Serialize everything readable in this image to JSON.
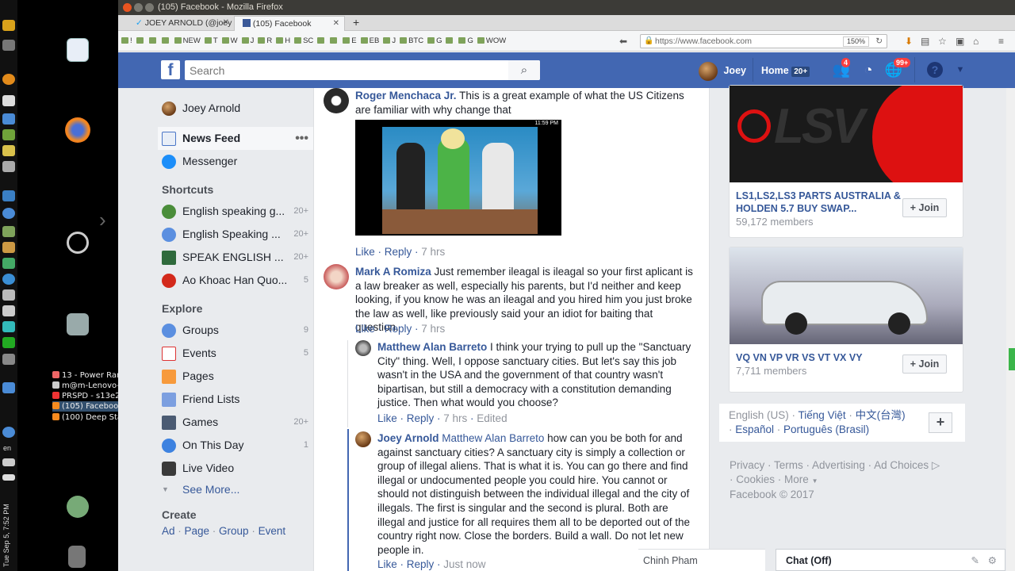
{
  "window": {
    "title": "(105) Facebook - Mozilla Firefox"
  },
  "tabs": [
    {
      "label": "JOEY ARNOLD (@joey"
    },
    {
      "label": "(105) Facebook"
    }
  ],
  "toolbar": {
    "url": "https://www.facebook.com",
    "zoom": "150%",
    "bookmarks": [
      "!",
      "",
      "",
      "",
      "NEW",
      "T",
      "W",
      "J",
      "R",
      "H",
      "SC",
      "",
      "",
      "E",
      "EB",
      "J",
      "BTC",
      "G",
      "",
      "G",
      "WOW"
    ]
  },
  "taskbar": {
    "items": [
      "13 - Power Ran...",
      "m@m-Lenovo-...",
      "PRSPD - s13e25...",
      "(105) Facebook...",
      "(100) Deep Sta..."
    ],
    "clock": "Tue Sep 5, 7:52 PM",
    "lang": "en"
  },
  "header": {
    "search_placeholder": "Search",
    "user": "Joey",
    "home": "Home",
    "home_count": "20+",
    "friend_badge": "4",
    "notif_badge": "99+"
  },
  "nav": {
    "profile": "Joey Arnold",
    "news_feed": "News Feed",
    "messenger": "Messenger",
    "shortcuts_title": "Shortcuts",
    "shortcuts": [
      {
        "label": "English speaking g...",
        "count": "20+"
      },
      {
        "label": "English Speaking ...",
        "count": "20+"
      },
      {
        "label": "SPEAK ENGLISH ...",
        "count": "20+"
      },
      {
        "label": "Ao Khoac Han Quo...",
        "count": "5"
      }
    ],
    "explore_title": "Explore",
    "explore": [
      {
        "label": "Groups",
        "count": "9"
      },
      {
        "label": "Events",
        "count": "5"
      },
      {
        "label": "Pages",
        "count": ""
      },
      {
        "label": "Friend Lists",
        "count": ""
      },
      {
        "label": "Games",
        "count": "20+"
      },
      {
        "label": "On This Day",
        "count": "1"
      },
      {
        "label": "Live Video",
        "count": ""
      }
    ],
    "see_more": "See More...",
    "create_title": "Create",
    "create_links": [
      "Ad",
      "Page",
      "Group",
      "Event"
    ]
  },
  "comments": [
    {
      "name": "Roger Menchaca Jr.",
      "text": "This is a great example of what the US Citizens are familiar with why change that",
      "time": "7 hrs"
    },
    {
      "name": "Mark A Romiza",
      "text": "Just remember ileagal is ileagal so your first aplicant is a law breaker as well, especially his parents, but I'd neither and keep looking, if you know he was an ileagal and you hired him you just broke the law as well, like previously said your an idiot for baiting that question.",
      "time": "7 hrs"
    },
    {
      "name": "Matthew Alan Barreto",
      "text": "I think your trying to pull up the \"Sanctuary City\" thing. Well, I oppose sanctuary cities. But let's say this job wasn't in the USA and the government of that country wasn't bipartisan, but still a democracy with a constitution demanding justice. Then what would you choose?",
      "time": "7 hrs",
      "edited": "Edited"
    },
    {
      "name": "Joey Arnold",
      "mention": "Matthew Alan Barreto",
      "text": "how can you be both for and against sanctuary cities? A sanctuary city is simply a collection or group of illegal aliens. That is what it is. You can go there and find illegal or undocumented people you could hire. You cannot or should not distinguish between the individual illegal and the city of illegals. The first is singular and the second is plural. Both are illegal and justice for all requires them all to be deported out of the country right now. Close the borders. Build a wall. Do not let new people in.",
      "time": "Just now"
    }
  ],
  "actions": {
    "like": "Like",
    "reply": "Reply"
  },
  "video": {
    "status": "11:59 PM"
  },
  "groups": [
    {
      "title": "LS1,LS2,LS3 PARTS AUSTRALIA & HOLDEN 5.7 BUY SWAP...",
      "members": "59,172 members",
      "join": "Join",
      "banner": "LSV"
    },
    {
      "title": "VQ VN VP VR VS VT VX VY",
      "members": "7,711 members",
      "join": "Join"
    }
  ],
  "footer": {
    "languages": [
      "English (US)",
      "Tiếng Việt",
      "中文(台灣)",
      "Español",
      "Português (Brasil)"
    ],
    "links": [
      "Privacy",
      "Terms",
      "Advertising",
      "Ad Choices",
      "Cookies",
      "More"
    ],
    "copyright": "Facebook © 2017"
  },
  "chat": {
    "friend": "Chinh Pham",
    "label": "Chat (Off)"
  },
  "colors": {
    "fb_blue": "#4267b2",
    "link": "#365899",
    "bg": "#e9ebee"
  }
}
